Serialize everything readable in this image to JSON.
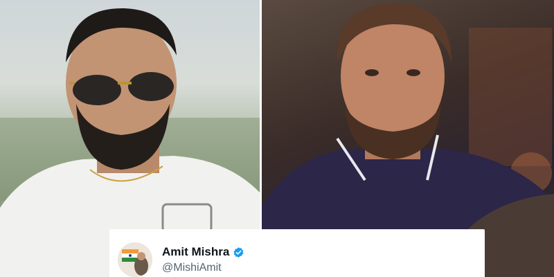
{
  "tweet": {
    "display_name": "Amit Mishra",
    "handle": "@MishiAmit",
    "verified_icon": "verified-badge-icon",
    "verified_color": "#1d9bf0"
  },
  "photos": {
    "left": "cricketer-portrait-sunglasses",
    "right": "cricketer-portrait-dark-jacket"
  }
}
